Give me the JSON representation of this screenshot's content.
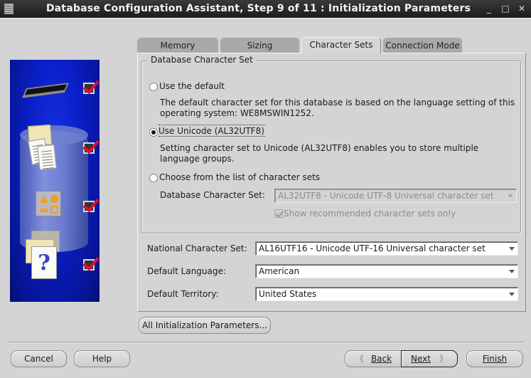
{
  "window": {
    "title": "Database Configuration Assistant, Step 9 of 11 : Initialization Parameters",
    "controls": {
      "minimize": "_",
      "maximize": "□",
      "close": "✕"
    }
  },
  "illustration": {
    "steps": [
      {
        "icon": "memory-chip",
        "completed": true
      },
      {
        "icon": "database-documents",
        "completed": true
      },
      {
        "icon": "shapes",
        "completed": true
      },
      {
        "icon": "help-documents",
        "completed": true
      }
    ]
  },
  "tabs": [
    {
      "label": "Memory",
      "active": false
    },
    {
      "label": "Sizing",
      "active": false
    },
    {
      "label": "Character Sets",
      "active": true
    },
    {
      "label": "Connection Mode",
      "active": false
    }
  ],
  "database_character_set": {
    "legend": "Database Character Set",
    "options": [
      {
        "label": "Use the default",
        "selected": false,
        "description": "The default character set for this database is based on the language setting of this operating system: WE8MSWIN1252."
      },
      {
        "label": "Use Unicode (AL32UTF8)",
        "selected": true,
        "description": "Setting character set to Unicode (AL32UTF8) enables you to store multiple language groups."
      },
      {
        "label": "Choose from the list of character sets",
        "selected": false
      }
    ],
    "charset_field": {
      "label": "Database Character Set:",
      "value": "AL32UTF8 - Unicode UTF-8 Universal character set",
      "enabled": false
    },
    "recommended_checkbox": {
      "label": "Show recommended character sets only",
      "checked": true,
      "enabled": false
    }
  },
  "fields": [
    {
      "label": "National Character Set:",
      "value": "AL16UTF16 - Unicode UTF-16 Universal character set"
    },
    {
      "label": "Default Language:",
      "value": "American"
    },
    {
      "label": "Default Territory:",
      "value": "United States"
    }
  ],
  "all_params_button": "All Initialization Parameters...",
  "footer": {
    "cancel": "Cancel",
    "help": "Help",
    "back": "Back",
    "next": "Next",
    "finish": "Finish",
    "back_arrow": "《",
    "next_arrow": "》"
  }
}
